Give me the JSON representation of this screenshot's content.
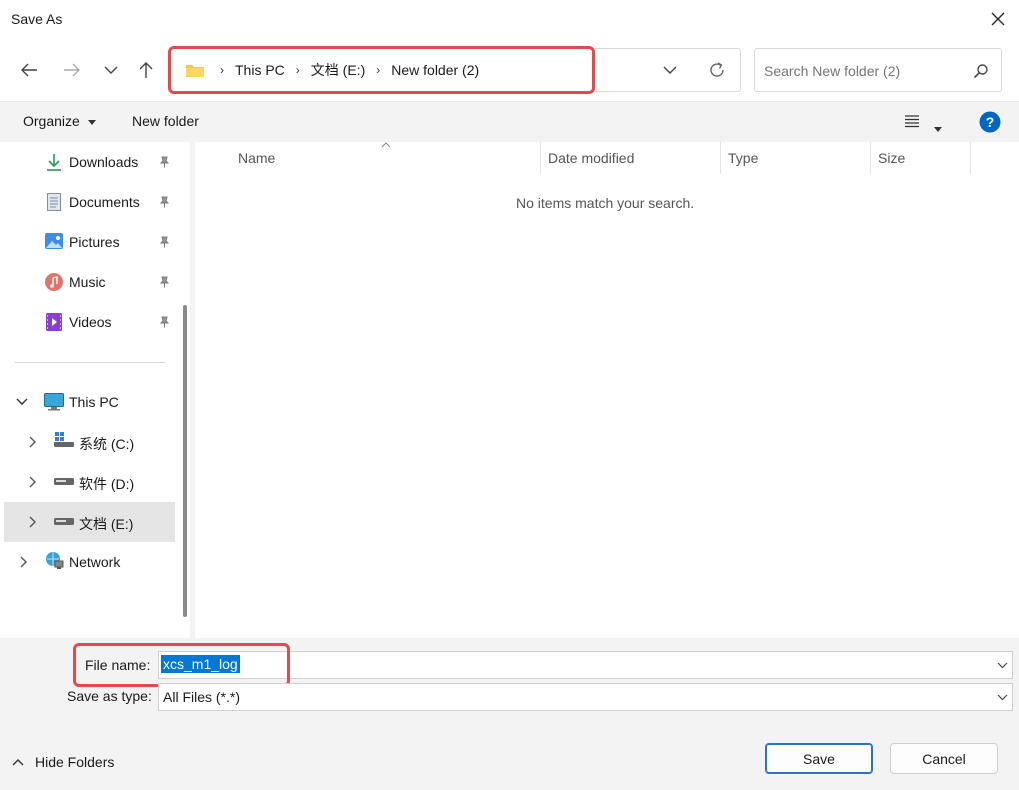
{
  "window": {
    "title": "Save As"
  },
  "address": {
    "crumbs": [
      "This PC",
      "文档 (E:)",
      "New folder (2)"
    ]
  },
  "search": {
    "placeholder": "Search New folder (2)"
  },
  "toolbar": {
    "organize": "Organize",
    "new_folder": "New folder"
  },
  "sidebar": {
    "quick": [
      {
        "label": "Downloads",
        "icon": "download-icon"
      },
      {
        "label": "Documents",
        "icon": "document-icon"
      },
      {
        "label": "Pictures",
        "icon": "pictures-icon"
      },
      {
        "label": "Music",
        "icon": "music-icon"
      },
      {
        "label": "Videos",
        "icon": "videos-icon"
      }
    ],
    "this_pc": "This PC",
    "drives": [
      "系统 (C:)",
      "软件 (D:)",
      "文档 (E:)"
    ],
    "network": "Network",
    "selected_drive_index": 2
  },
  "columns": [
    "Name",
    "Date modified",
    "Type",
    "Size"
  ],
  "empty_message": "No items match your search.",
  "form": {
    "file_name_label": "File name:",
    "file_name_value": "xcs_m1_log",
    "save_type_label": "Save as type:",
    "save_type_value": "All Files (*.*)"
  },
  "footer": {
    "hide_folders": "Hide Folders",
    "save": "Save",
    "cancel": "Cancel"
  },
  "colors": {
    "accent": "#0067c0",
    "highlight": "#e34a4a",
    "selection": "#0078d4"
  }
}
